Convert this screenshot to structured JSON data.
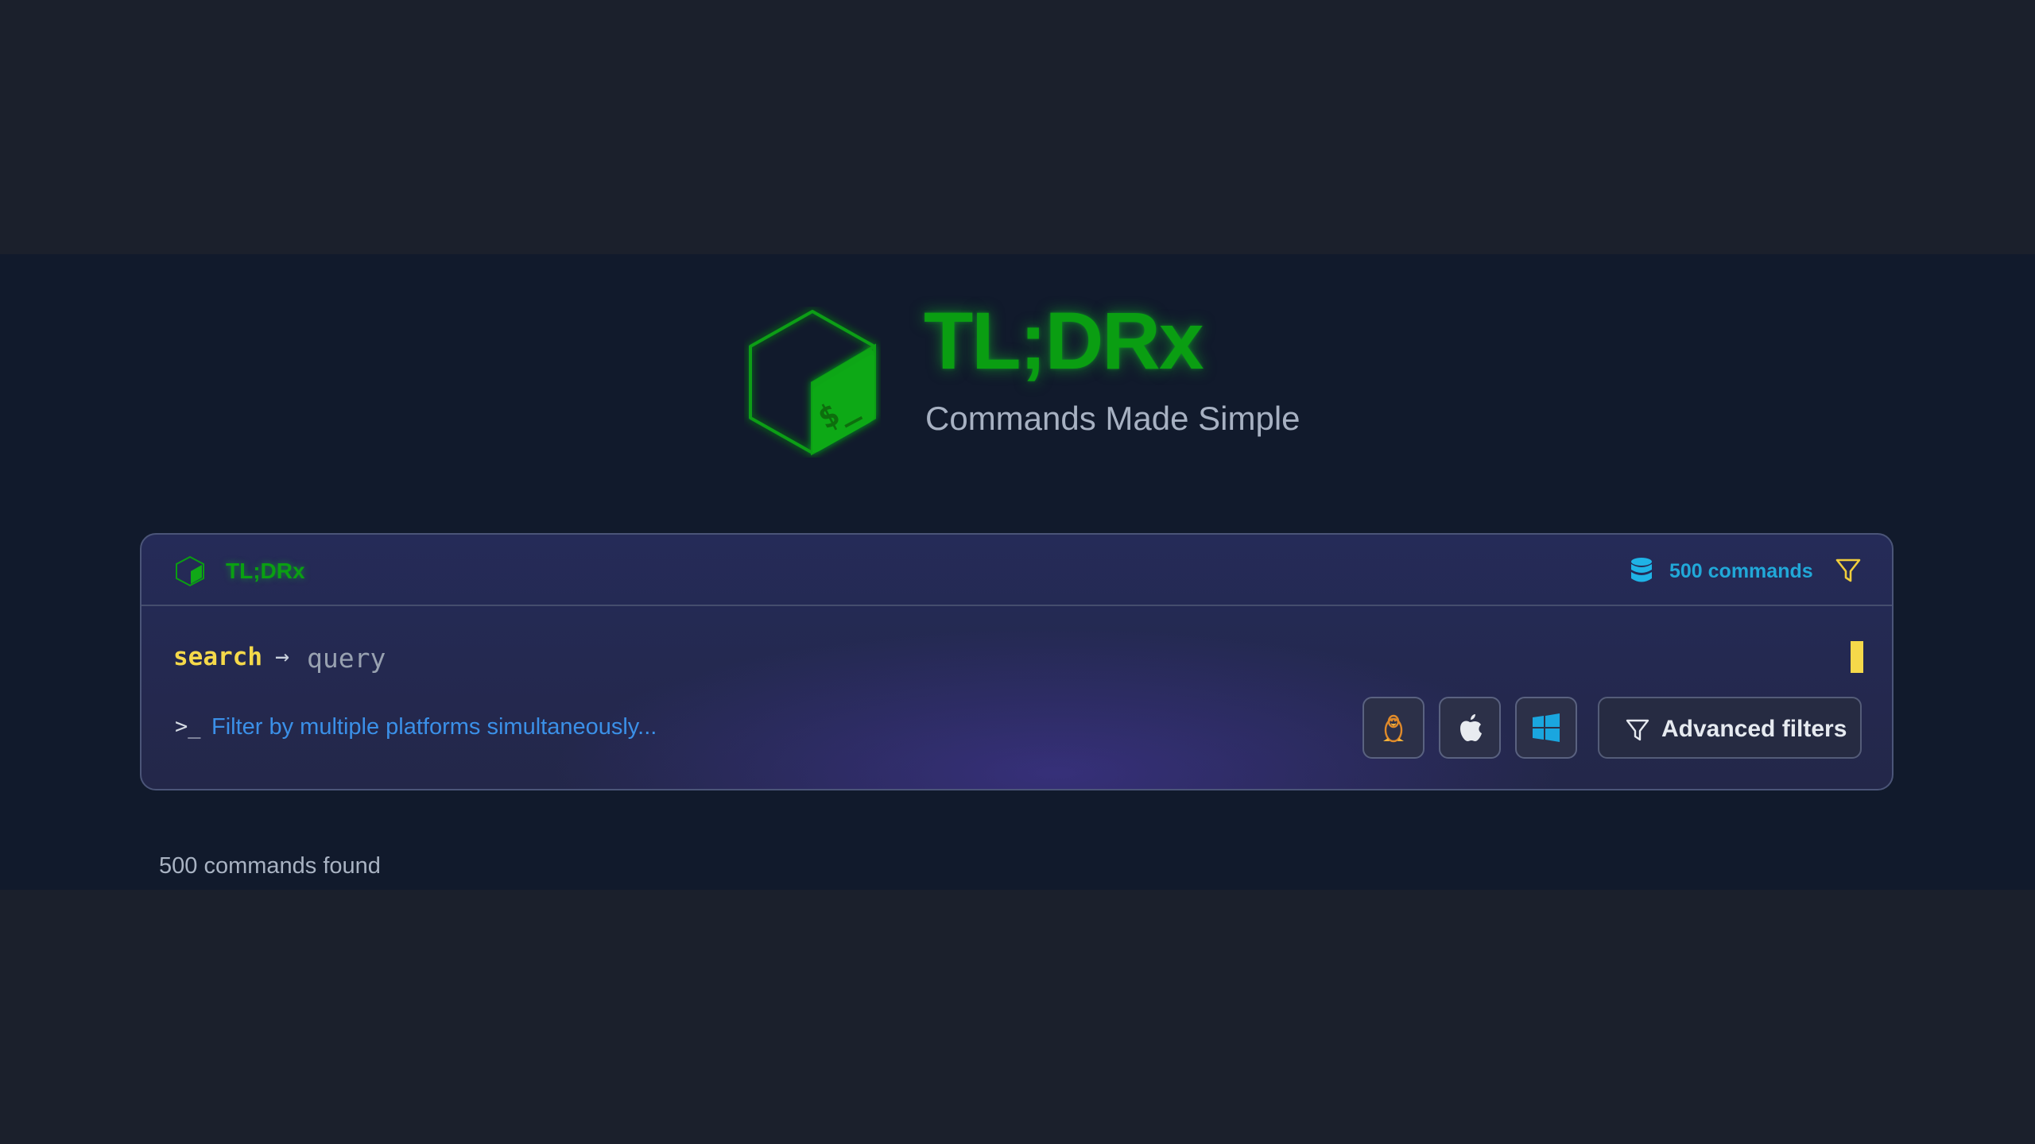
{
  "hero": {
    "title": "TL;DRx",
    "subtitle": "Commands Made Simple",
    "logo_icon": "bash-cube-logo-icon"
  },
  "card": {
    "header": {
      "brand": "TL;DRx",
      "brand_icon": "bash-cube-logo-icon",
      "count_label": "500 commands",
      "count_icon": "database-icon",
      "filter_icon": "funnel-icon"
    },
    "search": {
      "keyword": "search",
      "arrow": "→",
      "placeholder": "query",
      "value": ""
    },
    "hint": {
      "prompt": ">_",
      "text": "Filter by multiple platforms simultaneously..."
    },
    "platforms": [
      {
        "name": "linux",
        "icon": "linux-tux-icon"
      },
      {
        "name": "macos",
        "icon": "apple-icon"
      },
      {
        "name": "windows",
        "icon": "windows-icon"
      }
    ],
    "advanced_filters_label": "Advanced filters"
  },
  "results": {
    "count_text": "500 commands found"
  },
  "colors": {
    "page_bg": "#1b202c",
    "band_bg": "#111a2c",
    "brand_green": "#0a9e12",
    "keyword_yellow": "#f5d94a",
    "hint_blue": "#3b90e8",
    "count_cyan": "#21a8d8"
  }
}
